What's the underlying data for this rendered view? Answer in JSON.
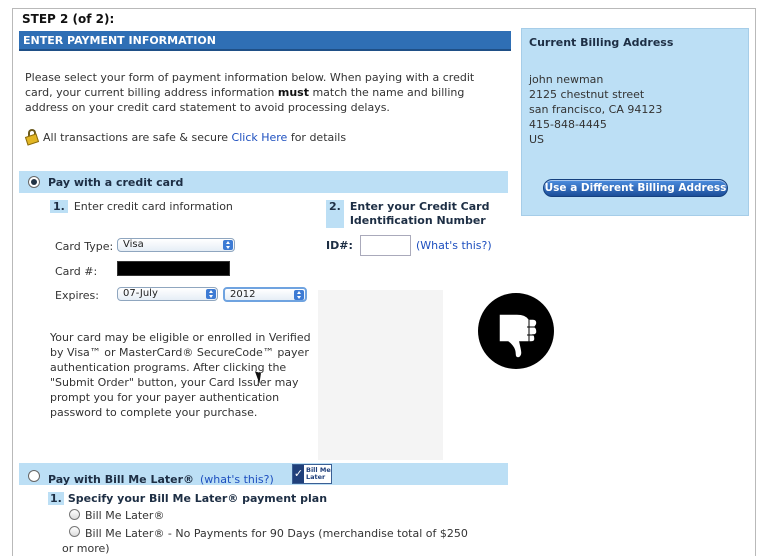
{
  "step": {
    "title": "STEP 2 (of 2):"
  },
  "payment_header": "ENTER PAYMENT INFORMATION",
  "intro": {
    "part1": "Please select your form of payment information below. When paying with a credit card, your current billing address information ",
    "bold": "must",
    "part2": " match the name and billing address on your credit card statement to avoid processing delays."
  },
  "secure": {
    "text": "All transactions are safe & secure ",
    "link": "Click Here",
    "suffix": " for details"
  },
  "billing": {
    "title": "Current Billing Address",
    "lines": [
      "john newman",
      "2125 chestnut street",
      "san francisco, CA  94123",
      "415-848-4445",
      "US"
    ],
    "button": "Use a Different Billing Address"
  },
  "credit_card": {
    "label": "Pay with a credit card",
    "selected": true,
    "step1": {
      "num": "1.",
      "text": "Enter credit card information"
    },
    "step2": {
      "num": "2.",
      "text": "Enter your Credit Card Identification Number"
    },
    "card_type_label": "Card Type:",
    "card_type_value": "Visa",
    "card_number_label": "Card #:",
    "expires_label": "Expires:",
    "exp_month": "07-July",
    "exp_year": "2012",
    "id_label": "ID#:",
    "id_value": "",
    "whats_this": "(What's this?)",
    "verified_text": "Your card may be eligible or enrolled in Verified by Visa™ or MasterCard® SecureCode™ payer authentication programs. After clicking the \"Submit Order\" button, your Card Issuer may prompt you for your payer authentication password to complete your purchase."
  },
  "bill_me_later": {
    "label": "Pay with Bill Me Later®",
    "selected": false,
    "link": "(what's this?)",
    "logo_text": [
      "Bill Me",
      "Later"
    ],
    "plan_num": "1.",
    "plan_title": "Specify your Bill Me Later® payment plan",
    "options": [
      "Bill Me Later®",
      "Bill Me Later® - No Payments for 90 Days (merchandise total of $250 or more)"
    ]
  },
  "icons": {
    "lock": "lock-icon",
    "thumb": "thumbs-down-icon",
    "cursor": "mouse-pointer-icon"
  }
}
